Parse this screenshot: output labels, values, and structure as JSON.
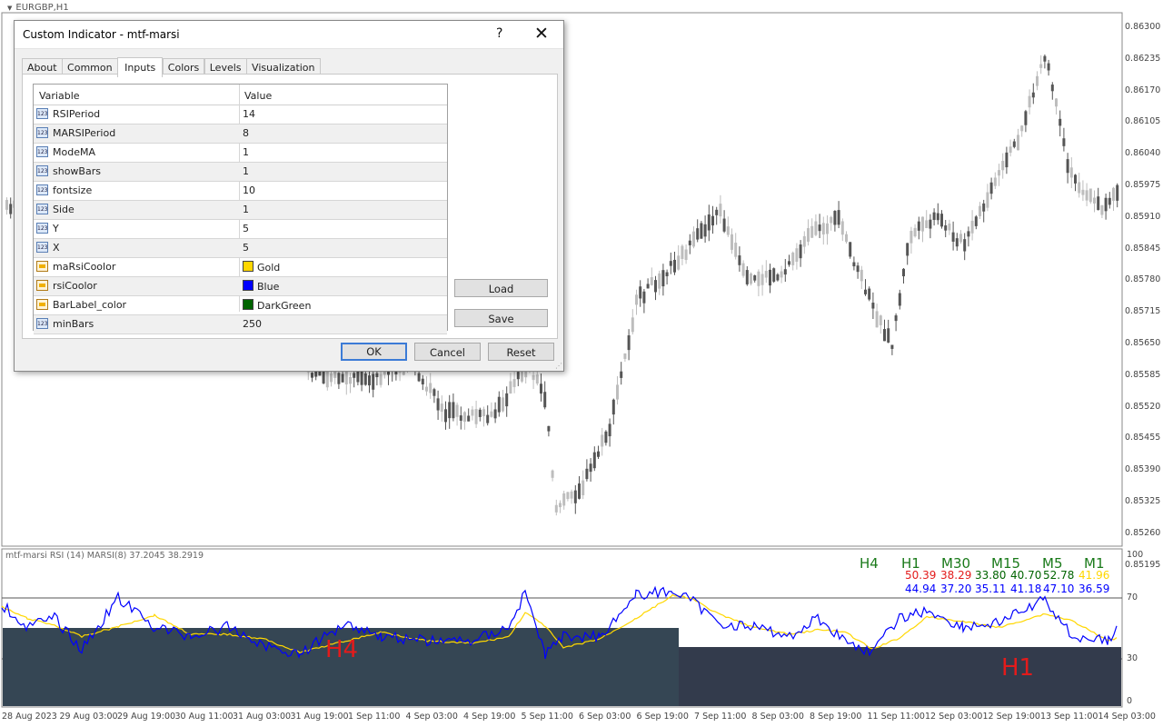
{
  "window": {
    "title": "EURGBP,H1"
  },
  "price_axis": [
    "0.86300",
    "0.86235",
    "0.86170",
    "0.86105",
    "0.86040",
    "0.85975",
    "0.85910",
    "0.85845",
    "0.85780",
    "0.85715",
    "0.85650",
    "0.85585",
    "0.85520",
    "0.85455",
    "0.85390",
    "0.85325",
    "0.85260",
    "0.85195"
  ],
  "time_axis": [
    "28 Aug 2023",
    "29 Aug 03:00",
    "29 Aug 19:00",
    "30 Aug 11:00",
    "31 Aug 03:00",
    "31 Aug 19:00",
    "1 Sep 11:00",
    "4 Sep 03:00",
    "4 Sep 19:00",
    "5 Sep 11:00",
    "6 Sep 03:00",
    "6 Sep 19:00",
    "7 Sep 11:00",
    "8 Sep 03:00",
    "8 Sep 19:00",
    "11 Sep 11:00",
    "12 Sep 03:00",
    "12 Sep 19:00",
    "13 Sep 11:00",
    "14 Sep 03:00"
  ],
  "indicator": {
    "label": "mtf-marsi  RSI (14)  MARSI(8) 37.2045 38.2919",
    "scale": [
      "100",
      "70",
      "30",
      "0"
    ],
    "timeframes": [
      "H4",
      "H1",
      "M30",
      "M15",
      "M5",
      "M1"
    ],
    "rsi_values": [
      "50.39",
      "38.29",
      "33.80",
      "40.70",
      "52.78",
      "41.96"
    ],
    "marsi_values": [
      "44.94",
      "37.20",
      "35.11",
      "41.18",
      "47.10",
      "36.59"
    ],
    "bar_labels": {
      "h4": "H4",
      "h1": "H1"
    }
  },
  "colors": {
    "gold": "#ffd700",
    "blue": "#0000ff",
    "darkgreen": "#006400",
    "red": "#e31b1b",
    "bar_h4": "#354654",
    "bar_h1": "#333b4c"
  },
  "dialog": {
    "title": "Custom Indicator - mtf-marsi",
    "help": "?",
    "tabs": [
      "About",
      "Common",
      "Inputs",
      "Colors",
      "Levels",
      "Visualization"
    ],
    "active_tab": "Inputs",
    "columns": [
      "Variable",
      "Value"
    ],
    "rows": [
      {
        "name": "RSIPeriod",
        "value": "14"
      },
      {
        "name": "MARSIPeriod",
        "value": "8"
      },
      {
        "name": "ModeMA",
        "value": "1"
      },
      {
        "name": "showBars",
        "value": "1"
      },
      {
        "name": "fontsize",
        "value": "10"
      },
      {
        "name": "Side",
        "value": "1"
      },
      {
        "name": "Y",
        "value": "5"
      },
      {
        "name": "X",
        "value": "5"
      },
      {
        "name": "maRsiCoolor",
        "value": "Gold",
        "color": "#ffd700"
      },
      {
        "name": "rsiCoolor",
        "value": "Blue",
        "color": "#0000ff"
      },
      {
        "name": "BarLabel_color",
        "value": "DarkGreen",
        "color": "#006400"
      },
      {
        "name": "minBars",
        "value": "250"
      }
    ],
    "buttons": {
      "load": "Load",
      "save": "Save",
      "ok": "OK",
      "cancel": "Cancel",
      "reset": "Reset"
    }
  }
}
